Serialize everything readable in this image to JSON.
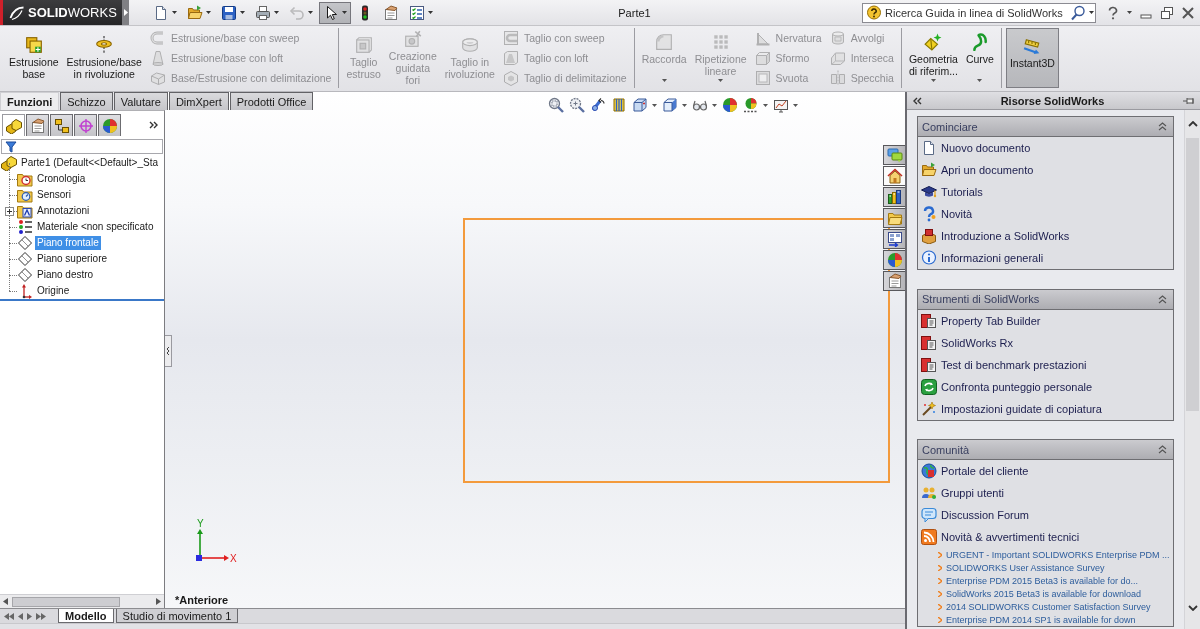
{
  "app": {
    "logo": "**SOLID**WORKS",
    "title": "Parte1",
    "search": {
      "placeholder": "Ricerca Guida in linea di SolidWorks"
    }
  },
  "quick_access": [
    {
      "kind": "new",
      "dropdown": true,
      "disabled": false,
      "pressed": false
    },
    {
      "kind": "open",
      "dropdown": true,
      "disabled": false,
      "pressed": false
    },
    {
      "kind": "save",
      "dropdown": true,
      "disabled": false,
      "pressed": false
    },
    {
      "kind": "print",
      "dropdown": true,
      "disabled": false,
      "pressed": false
    },
    {
      "kind": "undo",
      "dropdown": true,
      "disabled": true,
      "pressed": false
    },
    {
      "kind": "select",
      "dropdown": true,
      "disabled": false,
      "pressed": true
    },
    {
      "kind": "rebuild",
      "dropdown": false,
      "disabled": false,
      "pressed": false
    },
    {
      "kind": "file_properties",
      "dropdown": false,
      "disabled": false,
      "pressed": false
    },
    {
      "kind": "options",
      "dropdown": true,
      "disabled": false,
      "pressed": false
    }
  ],
  "ribbon": [
    {
      "buttons": [
        {
          "kind": "extrude",
          "label": "Estrusione\nbase",
          "disabled": false,
          "dropdown": false,
          "pressed": false
        },
        {
          "kind": "revolve",
          "label": "Estrusione/base\nin rivoluzione",
          "disabled": false,
          "dropdown": false,
          "pressed": false
        }
      ],
      "columns": [
        {
          "buttons": [
            {
              "kind": "sweep",
              "label": "Estrusione/base con sweep",
              "disabled": true
            },
            {
              "kind": "loft",
              "label": "Estrusione/base con loft",
              "disabled": true
            },
            {
              "kind": "boundary",
              "label": "Base/Estrusione con delimitazione",
              "disabled": true
            }
          ]
        }
      ]
    },
    {
      "buttons": [
        {
          "kind": "cut_extrude",
          "label": "Taglio\nestruso",
          "disabled": true,
          "dropdown": false,
          "pressed": false
        },
        {
          "kind": "hole_wizard",
          "label": "Creazione\nguidata\nfori",
          "disabled": true,
          "dropdown": false,
          "pressed": false
        },
        {
          "kind": "cut_revolve",
          "label": "Taglio in\nrivoluzione",
          "disabled": true,
          "dropdown": false,
          "pressed": false
        }
      ],
      "columns": [
        {
          "buttons": [
            {
              "kind": "cut_sweep",
              "label": "Taglio con sweep",
              "disabled": true
            },
            {
              "kind": "cut_loft",
              "label": "Taglio con loft",
              "disabled": true
            },
            {
              "kind": "cut_boundary",
              "label": "Taglio di delimitazione",
              "disabled": true
            }
          ]
        }
      ]
    },
    {
      "buttons": [
        {
          "kind": "fillet",
          "label": "Raccorda",
          "disabled": true,
          "dropdown": true,
          "pressed": false
        },
        {
          "kind": "pattern",
          "label": "Ripetizione\nlineare",
          "disabled": true,
          "dropdown": true,
          "pressed": false
        }
      ],
      "columns": [
        {
          "buttons": [
            {
              "kind": "rib",
              "label": "Nervatura",
              "disabled": true
            },
            {
              "kind": "draft",
              "label": "Sformo",
              "disabled": true
            },
            {
              "kind": "shell",
              "label": "Svuota",
              "disabled": true
            }
          ]
        },
        {
          "buttons": [
            {
              "kind": "wrap",
              "label": "Avvolgi",
              "disabled": true
            },
            {
              "kind": "intersect",
              "label": "Interseca",
              "disabled": true
            },
            {
              "kind": "mirror",
              "label": "Specchia",
              "disabled": true
            }
          ]
        }
      ]
    },
    {
      "buttons": [
        {
          "kind": "ref_geometry",
          "label": "Geometria\ndi riferim...",
          "disabled": false,
          "dropdown": true,
          "pressed": false
        },
        {
          "kind": "curves",
          "label": "Curve",
          "disabled": false,
          "dropdown": true,
          "pressed": false
        }
      ]
    },
    {
      "buttons": [
        {
          "kind": "instant3d",
          "label": "Instant3D",
          "disabled": false,
          "dropdown": false,
          "pressed": true
        }
      ]
    }
  ],
  "tabs": [
    {
      "label": "Funzioni",
      "selected": true
    },
    {
      "label": "Schizzo",
      "selected": false
    },
    {
      "label": "Valutare",
      "selected": false
    },
    {
      "label": "DimXpert",
      "selected": false
    },
    {
      "label": "Prodotti Office",
      "selected": false
    }
  ],
  "view_toolbar": [
    {
      "kind": "zoom_fit",
      "dropdown": false
    },
    {
      "kind": "zoom_area",
      "dropdown": false
    },
    {
      "kind": "previous_view",
      "dropdown": false
    },
    {
      "kind": "section_view",
      "dropdown": false
    },
    {
      "kind": "view_orientation",
      "dropdown": true
    },
    {
      "kind": "display_style",
      "dropdown": true
    },
    {
      "kind": "hide_show",
      "dropdown": true
    },
    {
      "kind": "edit_appearance",
      "dropdown": false
    },
    {
      "kind": "apply_scene",
      "dropdown": true
    },
    {
      "kind": "view_settings",
      "dropdown": true
    }
  ],
  "feature_manager": {
    "pane_tabs": [
      {
        "kind": "feature_tree",
        "selected": true
      },
      {
        "kind": "property_manager",
        "selected": false
      },
      {
        "kind": "configuration",
        "selected": false
      },
      {
        "kind": "dimxpert",
        "selected": false
      },
      {
        "kind": "display",
        "selected": false
      }
    ],
    "tree": {
      "label": "Parte1 (Default<<Default>_Sta",
      "kind": "part",
      "selected": false,
      "children": [
        {
          "label": "Cronologia",
          "kind": "history",
          "selected": false,
          "collapsed": false
        },
        {
          "label": "Sensori",
          "kind": "sensors",
          "selected": false,
          "collapsed": false
        },
        {
          "label": "Annotazioni",
          "kind": "annotations",
          "selected": false,
          "collapsed": true
        },
        {
          "label": "Materiale <non specificato",
          "kind": "material",
          "selected": false,
          "collapsed": false
        },
        {
          "label": "Piano frontale",
          "kind": "plane",
          "selected": true,
          "collapsed": false
        },
        {
          "label": "Piano superiore",
          "kind": "plane",
          "selected": false,
          "collapsed": false
        },
        {
          "label": "Piano destro",
          "kind": "plane",
          "selected": false,
          "collapsed": false
        },
        {
          "label": "Origine",
          "kind": "origin",
          "selected": false,
          "collapsed": false
        }
      ]
    }
  },
  "viewport": {
    "task_tabs": [
      {
        "kind": "forum",
        "selected": false
      },
      {
        "kind": "home",
        "selected": true
      },
      {
        "kind": "library",
        "selected": false
      },
      {
        "kind": "file_explorer",
        "selected": false
      },
      {
        "kind": "view_palette",
        "selected": false
      },
      {
        "kind": "appearances",
        "selected": false
      },
      {
        "kind": "custom_properties",
        "selected": false
      }
    ],
    "triad": {
      "y_label": "Y",
      "x_label": "X"
    },
    "view_name": "*Anteriore"
  },
  "bottom_tabs": [
    {
      "label": "Modello",
      "selected": true
    },
    {
      "label": "Studio di movimento 1",
      "selected": false
    }
  ],
  "task_pane": {
    "title": "Risorse SolidWorks",
    "sections": [
      {
        "title": "Cominciare",
        "expanded": true,
        "items": [
          {
            "label": "Nuovo documento",
            "kind": "new_document"
          },
          {
            "label": "Apri un documento",
            "kind": "open_document"
          },
          {
            "label": "Tutorials",
            "kind": "tutorials"
          },
          {
            "label": "Novità",
            "kind": "whats_new"
          },
          {
            "label": "Introduzione a SolidWorks",
            "kind": "introduction"
          },
          {
            "label": "Informazioni generali",
            "kind": "information"
          }
        ]
      },
      {
        "title": "Strumenti di SolidWorks",
        "expanded": true,
        "items": [
          {
            "label": "Property Tab Builder",
            "kind": "tab_builder"
          },
          {
            "label": "SolidWorks Rx",
            "kind": "rx"
          },
          {
            "label": "Test di benchmark prestazioni",
            "kind": "benchmark"
          },
          {
            "label": "Confronta punteggio personale",
            "kind": "compare"
          },
          {
            "label": "Impostazioni guidate di copiatura",
            "kind": "copy_settings"
          }
        ]
      },
      {
        "title": "Comunità",
        "expanded": true,
        "items": [
          {
            "label": "Portale del cliente",
            "kind": "portal"
          },
          {
            "label": "Gruppi utenti",
            "kind": "user_groups"
          },
          {
            "label": "Discussion Forum",
            "kind": "discussion_forum"
          },
          {
            "label": "Novità & avvertimenti tecnici",
            "kind": "rss"
          }
        ],
        "feed": [
          "URGENT - Important SOLIDWORKS Enterprise PDM ...",
          "SOLIDWORKS User Assistance Survey",
          "Enterprise PDM 2015 Beta3 is available for do...",
          "SolidWorks 2015 Beta3 is available for download",
          "2014 SOLIDWORKS Customer Satisfaction Survey",
          "Enterprise PDM 2014 SP1 is available for down"
        ]
      }
    ]
  }
}
